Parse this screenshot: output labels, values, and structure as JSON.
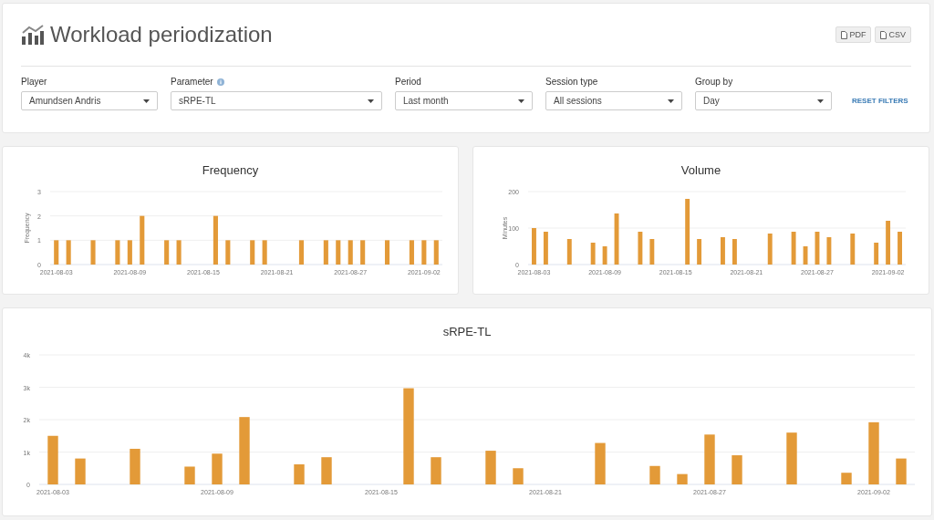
{
  "header": {
    "title": "Workload periodization",
    "buttons": [
      "PDF",
      "CSV"
    ]
  },
  "filters": [
    {
      "label": "Player",
      "value": "Amundsen Andris",
      "info": false
    },
    {
      "label": "Parameter",
      "value": "sRPE-TL",
      "info": true
    },
    {
      "label": "Period",
      "value": "Last month",
      "info": false
    },
    {
      "label": "Session type",
      "value": "All sessions",
      "info": false
    },
    {
      "label": "Group by",
      "value": "Day",
      "info": false
    }
  ],
  "reset_link": "RESET FILTERS",
  "charts": [
    {
      "chart_data": {
        "type": "bar",
        "title": "Frequency",
        "ylabel": "Frequency",
        "grid": true,
        "categories": [
          "2021-08-03",
          null,
          null,
          null,
          null,
          null,
          "2021-08-09",
          null,
          null,
          null,
          null,
          null,
          "2021-08-15",
          null,
          null,
          null,
          null,
          null,
          "2021-08-21",
          null,
          null,
          null,
          null,
          null,
          "2021-08-27",
          null,
          null,
          null,
          null,
          null,
          "2021-09-02",
          null
        ],
        "series": [
          {
            "color": "#e39a38",
            "values": [
              1,
              1,
              null,
              1,
              null,
              1,
              1,
              2,
              null,
              1,
              1,
              null,
              null,
              2,
              1,
              null,
              1,
              1,
              null,
              null,
              1,
              null,
              1,
              1,
              1,
              1,
              null,
              1,
              null,
              1,
              1,
              1
            ]
          }
        ],
        "ylim": [
          0,
          3
        ],
        "yticks": [
          0,
          1,
          2,
          3
        ]
      }
    },
    {
      "chart_data": {
        "type": "bar",
        "title": "Volume",
        "ylabel": "Minutes",
        "grid": true,
        "categories": [
          "2021-08-03",
          null,
          null,
          null,
          null,
          null,
          "2021-08-09",
          null,
          null,
          null,
          null,
          null,
          "2021-08-15",
          null,
          null,
          null,
          null,
          null,
          "2021-08-21",
          null,
          null,
          null,
          null,
          null,
          "2021-08-27",
          null,
          null,
          null,
          null,
          null,
          "2021-09-02",
          null
        ],
        "series": [
          {
            "color": "#e39a38",
            "values": [
              100,
              90,
              null,
              70,
              null,
              60,
              50,
              140,
              null,
              90,
              70,
              null,
              null,
              180,
              70,
              null,
              75,
              70,
              null,
              null,
              85,
              null,
              90,
              50,
              90,
              75,
              null,
              85,
              null,
              60,
              120,
              90
            ]
          }
        ],
        "ylim": [
          0,
          200
        ],
        "yticks": [
          0,
          100,
          200
        ]
      }
    },
    {
      "chart_data": {
        "type": "bar",
        "title": "sRPE-TL",
        "grid": true,
        "categories": [
          "2021-08-03",
          null,
          null,
          null,
          null,
          null,
          "2021-08-09",
          null,
          null,
          null,
          null,
          null,
          "2021-08-15",
          null,
          null,
          null,
          null,
          null,
          "2021-08-21",
          null,
          null,
          null,
          null,
          null,
          "2021-08-27",
          null,
          null,
          null,
          null,
          null,
          "2021-09-02",
          null
        ],
        "series": [
          {
            "color": "#e39a38",
            "values": [
              1500,
              800,
              null,
              1100,
              null,
              550,
              950,
              2080,
              null,
              620,
              840,
              null,
              null,
              2970,
              840,
              null,
              1040,
              500,
              null,
              null,
              1280,
              null,
              570,
              320,
              1540,
              900,
              null,
              1600,
              null,
              360,
              1920,
              800
            ]
          }
        ],
        "ylim": [
          0,
          4000
        ],
        "yticks": [
          0,
          {
            "value": 1000,
            "label": "1k"
          },
          {
            "value": 2000,
            "label": "2k"
          },
          {
            "value": 3000,
            "label": "3k"
          },
          {
            "value": 4000,
            "label": "4k"
          }
        ]
      }
    }
  ]
}
